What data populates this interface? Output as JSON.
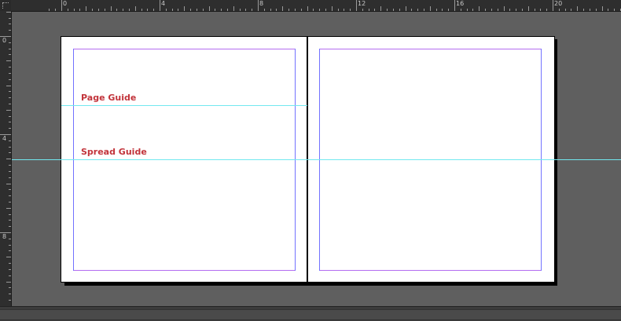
{
  "ruler": {
    "horizontal_labels": [
      "0",
      "4",
      "8",
      "12",
      "16",
      "20"
    ],
    "vertical_labels": [
      "0",
      "4",
      "8"
    ]
  },
  "guides": {
    "page_guide_label": "Page Guide",
    "spread_guide_label": "Spread Guide"
  },
  "colors": {
    "margin": "#b36cf0",
    "column": "#7272ff",
    "guide": "#72e8f0",
    "label": "#c2343b",
    "pasteboard": "#5f5f5f"
  }
}
